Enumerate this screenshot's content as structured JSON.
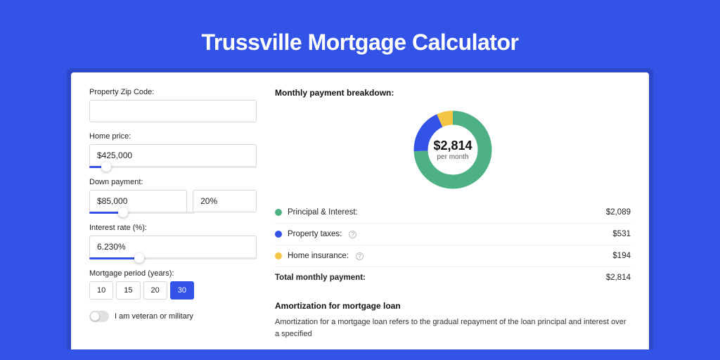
{
  "title": "Trussville Mortgage Calculator",
  "form": {
    "zip": {
      "label": "Property Zip Code:",
      "value": ""
    },
    "home_price": {
      "label": "Home price:",
      "value": "$425,000",
      "slider_pct": 10
    },
    "down_payment": {
      "label": "Down payment:",
      "amount": "$85,000",
      "percent": "20%",
      "slider_pct": 20
    },
    "interest": {
      "label": "Interest rate (%):",
      "value": "6.230%",
      "slider_pct": 30
    },
    "period": {
      "label": "Mortgage period (years):",
      "options": [
        "10",
        "15",
        "20",
        "30"
      ],
      "selected": "30"
    },
    "veteran": {
      "label": "I am veteran or military",
      "on": false
    }
  },
  "breakdown": {
    "title": "Monthly payment breakdown:",
    "center_amount": "$2,814",
    "center_sub": "per month",
    "items": [
      {
        "label": "Principal & Interest:",
        "amount": "$2,089",
        "color": "#4eb085",
        "info": false
      },
      {
        "label": "Property taxes:",
        "amount": "$531",
        "color": "#3353e6",
        "info": true
      },
      {
        "label": "Home insurance:",
        "amount": "$194",
        "color": "#f2c544",
        "info": true
      }
    ],
    "total": {
      "label": "Total monthly payment:",
      "amount": "$2,814"
    }
  },
  "chart_data": {
    "type": "pie",
    "title": "Monthly payment breakdown",
    "series": [
      {
        "name": "Principal & Interest",
        "value": 2089,
        "color": "#4eb085"
      },
      {
        "name": "Property taxes",
        "value": 531,
        "color": "#3353e6"
      },
      {
        "name": "Home insurance",
        "value": 194,
        "color": "#f2c544"
      }
    ],
    "total": 2814
  },
  "amortization": {
    "title": "Amortization for mortgage loan",
    "text": "Amortization for a mortgage loan refers to the gradual repayment of the loan principal and interest over a specified"
  }
}
